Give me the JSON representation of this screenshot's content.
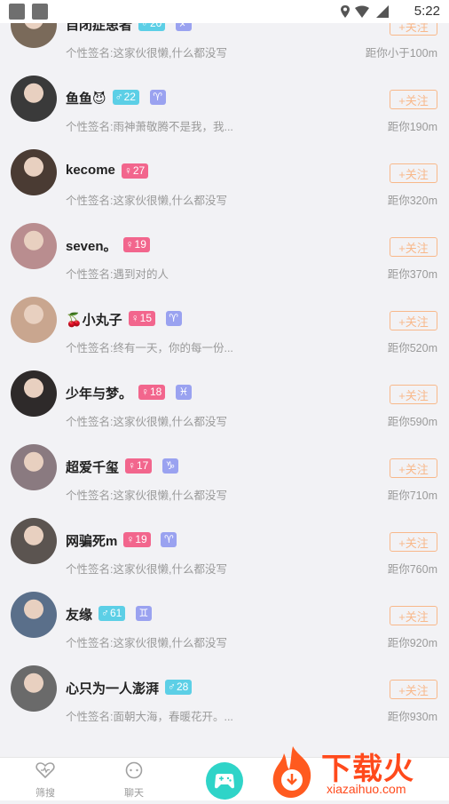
{
  "status_bar": {
    "time": "5:22"
  },
  "users": [
    {
      "nickname": "自闭症患者",
      "gender": "male",
      "age": "20",
      "zodiac": "♐",
      "signature": "个性签名:这家伙很懒,什么都没写",
      "distance": "距你小于100m",
      "follow_label": "+关注",
      "avatar_color": "#7a6a5a"
    },
    {
      "nickname": "鱼鱼😈",
      "gender": "male",
      "age": "22",
      "zodiac": "♈",
      "signature": "个性签名:雨神萧敬腾不是我，我...",
      "distance": "距你190m",
      "follow_label": "+关注",
      "avatar_color": "#3a3a3a"
    },
    {
      "nickname": "kecome",
      "gender": "female",
      "age": "27",
      "zodiac": "",
      "signature": "个性签名:这家伙很懒,什么都没写",
      "distance": "距你320m",
      "follow_label": "+关注",
      "avatar_color": "#4a3b33"
    },
    {
      "nickname": "seven。",
      "gender": "female",
      "age": "19",
      "zodiac": "",
      "signature": "个性签名:遇到对的人",
      "distance": "距你370m",
      "follow_label": "+关注",
      "avatar_color": "#b98d8f"
    },
    {
      "nickname": "🍒小丸子",
      "gender": "female",
      "age": "15",
      "zodiac": "♈",
      "signature": "个性签名:终有一天，你的每一份...",
      "distance": "距你520m",
      "follow_label": "+关注",
      "avatar_color": "#c9a68f"
    },
    {
      "nickname": "少年与梦。",
      "gender": "female",
      "age": "18",
      "zodiac": "♓",
      "signature": "个性签名:这家伙很懒,什么都没写",
      "distance": "距你590m",
      "follow_label": "+关注",
      "avatar_color": "#2e2a2a"
    },
    {
      "nickname": "超爱千玺",
      "gender": "female",
      "age": "17",
      "zodiac": "♑",
      "signature": "个性签名:这家伙很懒,什么都没写",
      "distance": "距你710m",
      "follow_label": "+关注",
      "avatar_color": "#8a7a80"
    },
    {
      "nickname": "网骗死m",
      "gender": "female",
      "age": "19",
      "zodiac": "♈",
      "signature": "个性签名:这家伙很懒,什么都没写",
      "distance": "距你760m",
      "follow_label": "+关注",
      "avatar_color": "#5b5450"
    },
    {
      "nickname": "友缘",
      "gender": "male",
      "age": "61",
      "zodiac": "♊",
      "signature": "个性签名:这家伙很懒,什么都没写",
      "distance": "距你920m",
      "follow_label": "+关注",
      "avatar_color": "#5a6f8a"
    },
    {
      "nickname": "心只为一人澎湃",
      "gender": "male",
      "age": "28",
      "zodiac": "",
      "signature": "个性签名:面朝大海，春暖花开。...",
      "distance": "距你930m",
      "follow_label": "+关注",
      "avatar_color": "#6a6a6a"
    }
  ],
  "tabbar": {
    "tabs": [
      {
        "label": "筛搜",
        "icon": "heart-icon"
      },
      {
        "label": "聊天",
        "icon": "chat-icon"
      }
    ],
    "center_icon": "gamepad-icon"
  },
  "watermark": {
    "text": "下载火",
    "url": "xiazaihuo.com"
  },
  "colors": {
    "male": "#5ccfe6",
    "female": "#f2668d",
    "follow": "#f8b88a",
    "zodiac": "#9aa2f0"
  }
}
